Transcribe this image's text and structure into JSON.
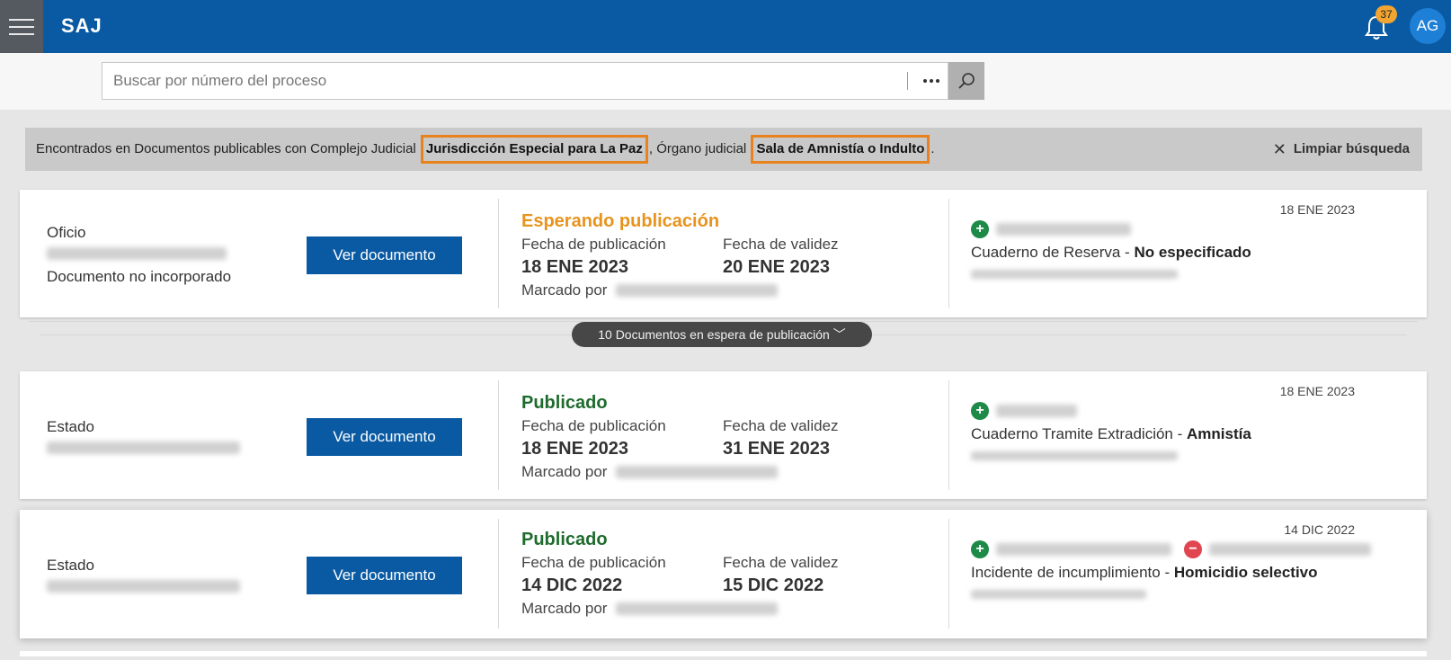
{
  "header": {
    "brand": "SAJ",
    "notifications_count": "37",
    "avatar_initials": "AG",
    "colors": {
      "bar": "#0a5aa3",
      "menu": "#555a60",
      "badge": "#f2a531"
    }
  },
  "search": {
    "placeholder": "Buscar por número del proceso",
    "value": ""
  },
  "filter": {
    "prefix": "Encontrados en Documentos publicables con Complejo Judicial",
    "complejo": "Jurisdicción Especial para La Paz",
    "organo_label": "Órgano judicial",
    "organo": "Sala de Amnistía o Indulto",
    "clear_label": "Limpiar búsqueda"
  },
  "labels": {
    "ver_documento": "Ver documento",
    "fecha_publicacion": "Fecha de publicación",
    "fecha_validez": "Fecha de validez",
    "marcado_por": "Marcado por"
  },
  "cards": [
    {
      "type": "Oficio",
      "note": "Documento no incorporado",
      "status": "Esperando publicación",
      "status_color": "#e8931c",
      "fecha_publicacion": "18 ENE 2023",
      "fecha_validez": "20 ENE 2023",
      "date": "18 ENE 2023",
      "cuaderno": "Cuaderno de Reserva",
      "delito": "No especificado"
    },
    {
      "type": "Estado",
      "status": "Publicado",
      "status_color": "#1f6b2d",
      "fecha_publicacion": "18 ENE 2023",
      "fecha_validez": "31 ENE 2023",
      "date": "18 ENE 2023",
      "cuaderno": "Cuaderno Tramite Extradición",
      "delito": "Amnistía"
    },
    {
      "type": "Estado",
      "status": "Publicado",
      "status_color": "#1f6b2d",
      "fecha_publicacion": "14 DIC 2022",
      "fecha_validez": "15 DIC 2022",
      "date": "14 DIC 2022",
      "cuaderno": "Incidente de incumplimiento",
      "delito": "Homicidio selectivo"
    }
  ],
  "pending": {
    "label": "10 Documentos en espera de publicación"
  }
}
